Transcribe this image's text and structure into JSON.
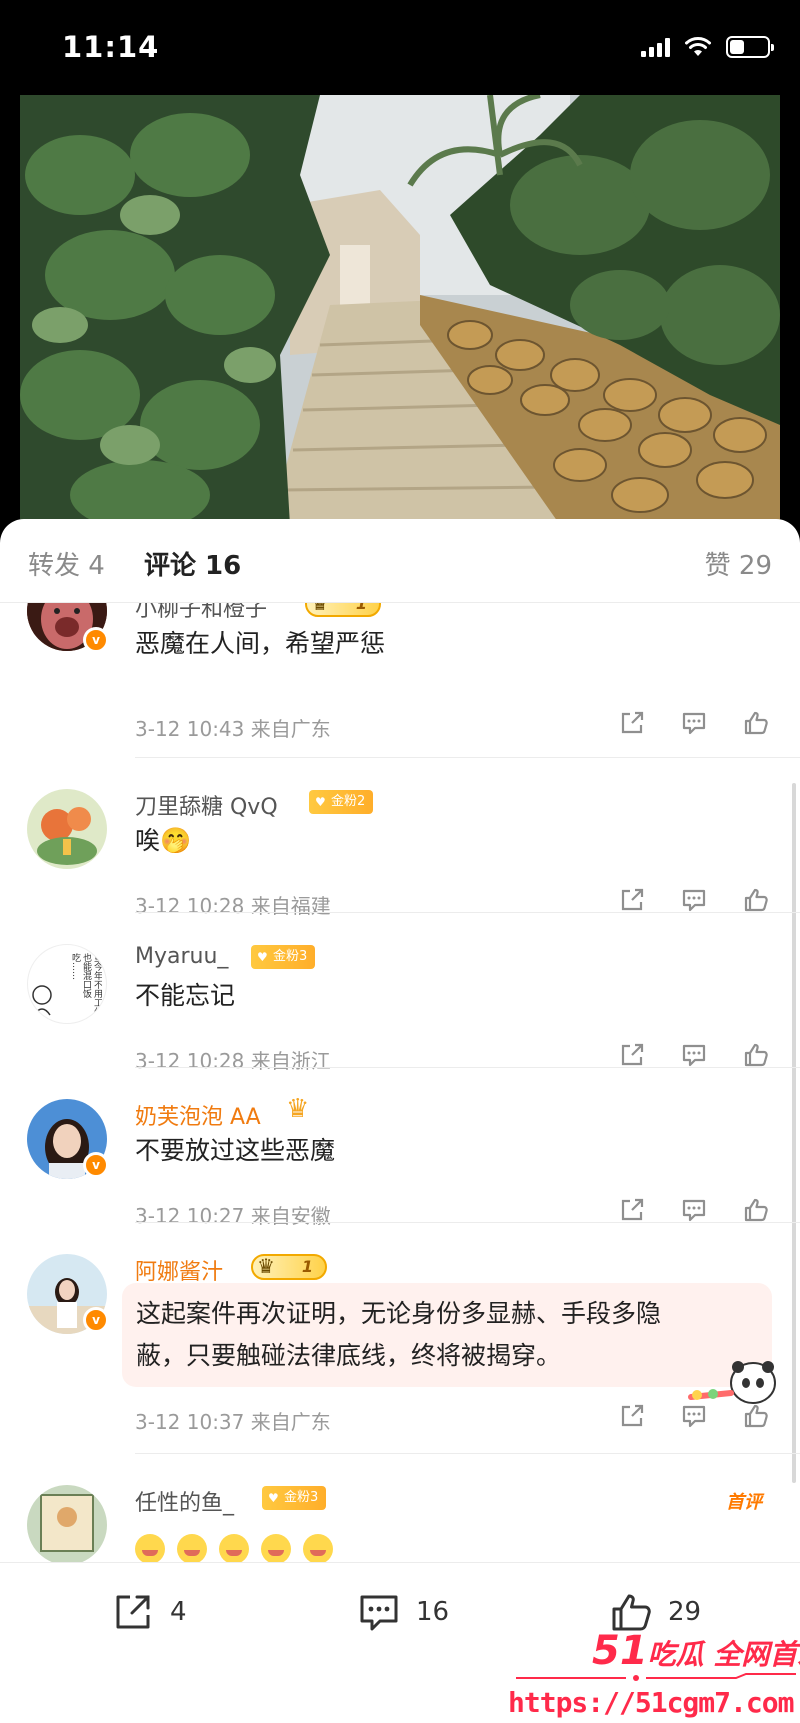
{
  "status_bar": {
    "time": "11:14"
  },
  "tabs": {
    "repost": "转发 4",
    "comments": "评论 16",
    "likes": "赞 29"
  },
  "comments": [
    {
      "username": "小柳子和橙子",
      "level": "1",
      "text": "恶魔在人间，希望严惩",
      "time": "3-12 10:43",
      "location": "来自广东"
    },
    {
      "username": "刀里舔糖 QvQ",
      "fan_badge": "金粉2",
      "text": "唉🤭",
      "time": "3-12 10:28",
      "location": "来自福建"
    },
    {
      "username": "Myaruu_",
      "fan_badge": "金粉3",
      "text": "不能忘记",
      "time": "3-12 10:28",
      "location": "来自浙江"
    },
    {
      "username": "奶芙泡泡 AA",
      "text": "不要放过这些恶魔",
      "time": "3-12 10:27",
      "location": "来自安徽"
    },
    {
      "username": "阿娜酱汁",
      "level": "1",
      "text_line1": "这起案件再次证明，无论身份多显赫、手段多隐",
      "text_line2": "蔽，只要触碰法律底线，终将被揭穿。",
      "time": "3-12 10:37",
      "location": "来自广东"
    },
    {
      "username": "任性的鱼_",
      "fan_badge": "金粉3",
      "tag": "首评"
    }
  ],
  "avatar_text": {
    "myaruu": "望今年不用工作也能混口饭吃……"
  },
  "bottom_bar": {
    "repost_count": "4",
    "comment_count": "16",
    "like_count": "29"
  },
  "watermark": {
    "brand_num": "51",
    "brand_text": "吃瓜 全网首发",
    "url": "https://51cgm7.com"
  },
  "colors": {
    "accent": "#ff8200",
    "vip_name": "#f07b10",
    "watermark": "#ff2a4a"
  }
}
